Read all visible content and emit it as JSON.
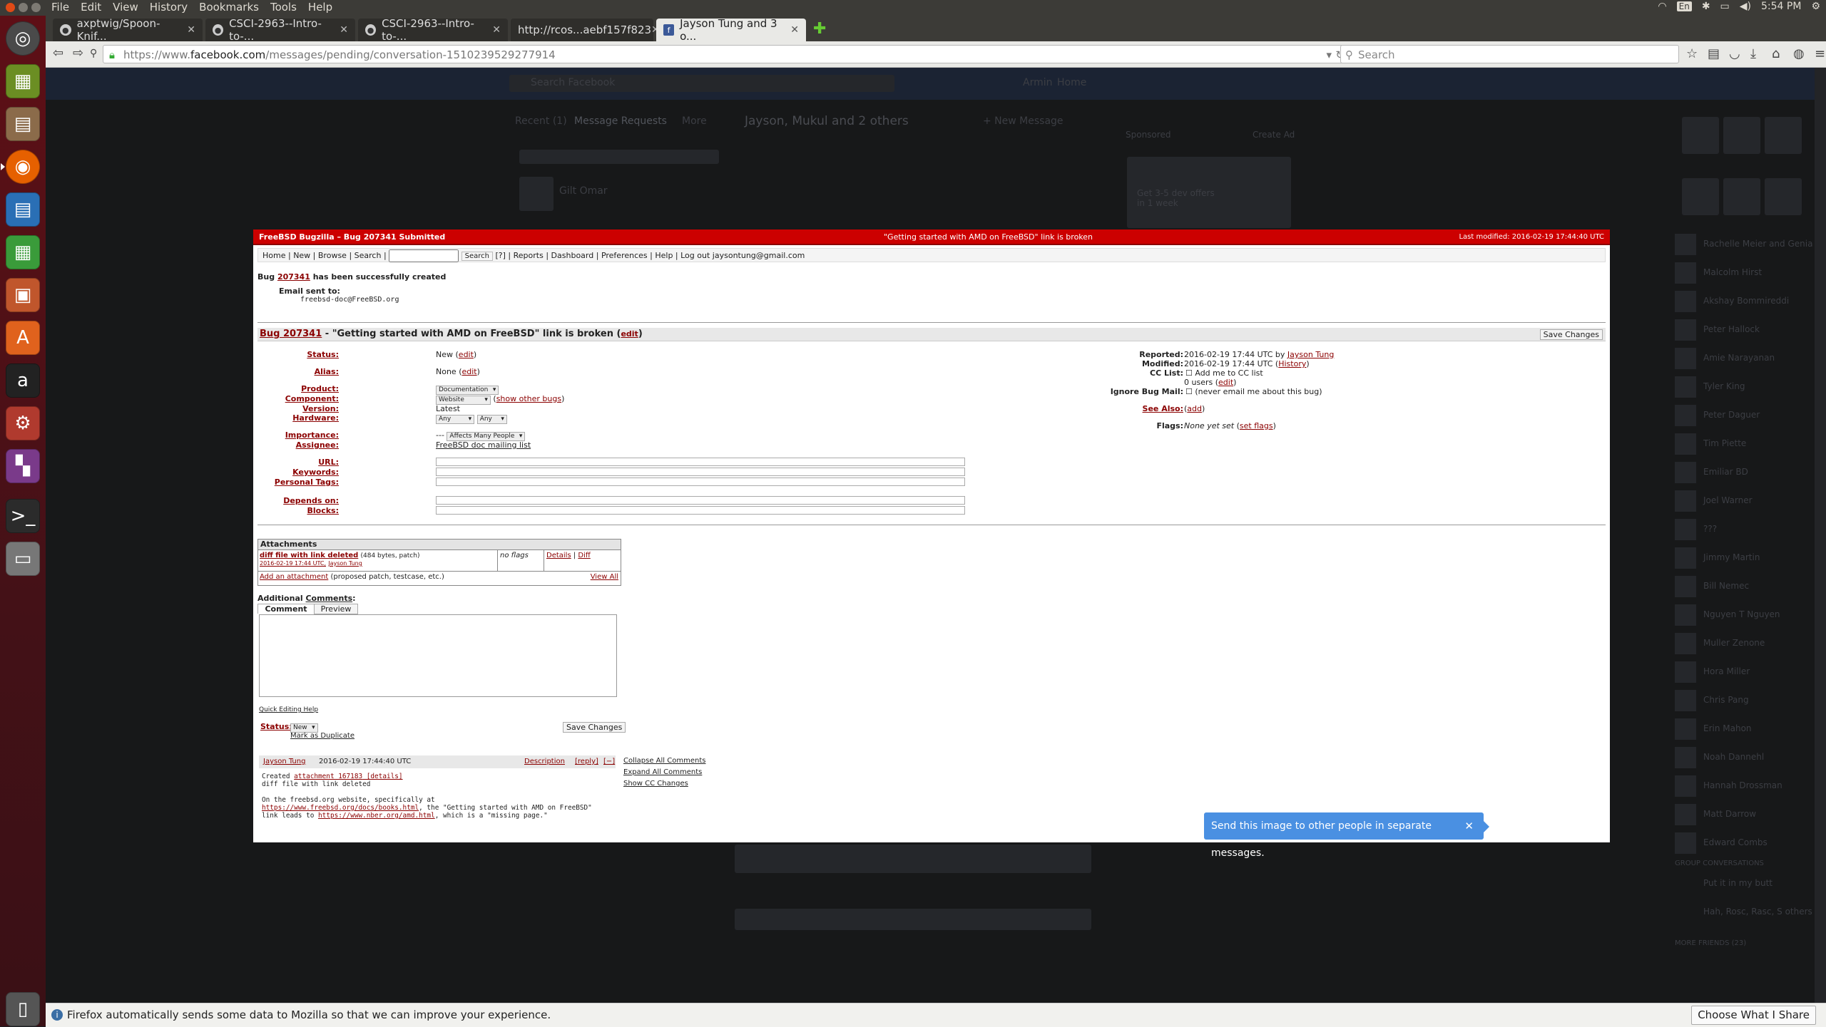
{
  "system": {
    "menu": [
      "File",
      "Edit",
      "View",
      "History",
      "Bookmarks",
      "Tools",
      "Help"
    ],
    "keyboard": "En",
    "clock": "5:54 PM"
  },
  "browser": {
    "tabs": [
      {
        "label": "axptwig/Spoon-Knif...",
        "icon": "github-icon",
        "active": false
      },
      {
        "label": "CSCI-2963--Intro-to-...",
        "icon": "github-icon",
        "active": false
      },
      {
        "label": "CSCI-2963--Intro-to-...",
        "icon": "github-icon",
        "active": false
      },
      {
        "label": "http://rcos...aebf157f823",
        "icon": "",
        "active": false
      },
      {
        "label": "Jayson Tung and 3 o...",
        "icon": "facebook-icon",
        "active": true
      }
    ],
    "url_prefix": "https://www.",
    "url_domain": "facebook.com",
    "url_path": "/messages/pending/conversation-1510239529277914",
    "search_placeholder": "Search"
  },
  "facebook_bg": {
    "search_placeholder": "Search Facebook",
    "user": "Armin",
    "home": "Home",
    "recent": "Recent (1)",
    "message_requests": "Message Requests",
    "more": "More",
    "conversation_title": "Jayson, Mukul and 2 others",
    "new_message": "+ New Message",
    "contact_name": "Gilt Omar",
    "sponsored": "Sponsored",
    "create_ad": "Create Ad",
    "ad_text": "Get 3-5 dev offers in 1 week",
    "chat_people": [
      "Rachelle Meier and Genia",
      "Malcolm Hirst",
      "Akshay Bommireddi",
      "Peter Hallock",
      "Amie Narayanan",
      "Tyler King",
      "Peter Daguer",
      "Tim Piette",
      "Emiliar BD",
      "Joel Warner",
      "???",
      "Jimmy Martin",
      "Bill Nemec",
      "Nguyen T Nguyen",
      "Muller Zenone",
      "Hora Miller",
      "Chris Pang",
      "Erin Mahon",
      "Noah Dannehl",
      "Hannah Drossman",
      "Matt Darrow",
      "Edward Combs"
    ],
    "group_conversations": "GROUP CONVERSATIONS",
    "group_items": [
      "Put it in my butt",
      "Hah, Rosc, Rasc, S others"
    ],
    "more_friends": "MORE FRIENDS (23)"
  },
  "bugzilla": {
    "header_title": "FreeBSD Bugzilla – Bug 207341 Submitted",
    "header_summary": "\"Getting started with AMD on FreeBSD\" link is broken",
    "header_modified": "Last modified: 2016-02-19 17:44:40 UTC",
    "nav": {
      "home": "Home",
      "new": "New",
      "browse": "Browse",
      "search": "Search",
      "search_button": "Search",
      "help_q": "[?]",
      "reports": "Reports",
      "dashboard": "Dashboard",
      "preferences": "Preferences",
      "help": "Help",
      "logout": "Log out",
      "email": "jaysontung@gmail.com"
    },
    "created_prefix": "Bug",
    "bug_id": "207341",
    "created_suffix": "has been successfully created",
    "email_sent_label": "Email sent to:",
    "email_sent_to": "freebsd-doc@FreeBSD.org",
    "title_bug": "Bug 207341",
    "title_text": " - \"Getting started with AMD on FreeBSD\" link is broken",
    "edit": "edit",
    "save_changes": "Save Changes",
    "fields": {
      "status_label": "Status:",
      "status_value": "New",
      "alias_label": "Alias:",
      "alias_value": "None",
      "product_label": "Product:",
      "product_value": "Documentation",
      "component_label": "Component:",
      "component_value": "Website",
      "show_other_bugs": "show other bugs",
      "version_label": "Version:",
      "version_value": "Latest",
      "hardware_label": "Hardware:",
      "hardware_value1": "Any",
      "hardware_value2": "Any",
      "importance_label": "Importance:",
      "importance_prefix": "---",
      "importance_value": "Affects Many People",
      "assignee_label": "Assignee:",
      "assignee_value": "FreeBSD doc mailing list",
      "url_label": "URL:",
      "keywords_label": "Keywords:",
      "personal_tags_label": "Personal Tags:",
      "depends_label": "Depends on:",
      "blocks_label": "Blocks:"
    },
    "right": {
      "reported_label": "Reported:",
      "reported_value": "2016-02-19 17:44 UTC by",
      "reporter": "Jayson Tung",
      "modified_label": "Modified:",
      "modified_value": "2016-02-19 17:44 UTC",
      "history": "History",
      "cc_label": "CC List:",
      "cc_add": "Add me to CC list",
      "cc_users": "0 users",
      "ignore_label": "Ignore Bug Mail:",
      "ignore_text": "(never email me about this bug)",
      "see_also_label": "See Also:",
      "add": "add",
      "flags_label": "Flags:",
      "flags_value": "None yet set",
      "set_flags": "set flags"
    },
    "attachments": {
      "header": "Attachments",
      "name": "diff file with link deleted",
      "meta": "(484 bytes, patch)",
      "date": "2016-02-19 17:44 UTC,",
      "author": "Jayson Tung",
      "flags": "no flags",
      "details": "Details",
      "diff": "Diff",
      "add": "Add an attachment",
      "add_hint": "(proposed patch, testcase, etc.)",
      "view_all": "View All"
    },
    "comments": {
      "label_a": "Additional ",
      "label_b": "Comments",
      "tab_comment": "Comment",
      "tab_preview": "Preview",
      "quick_help": "Quick Editing Help",
      "status_label": "Status:",
      "status_value": "New",
      "mark_dup": "Mark as Duplicate",
      "save_changes": "Save Changes"
    },
    "description": {
      "author": "Jayson Tung",
      "date": "2016-02-19 17:44:40 UTC",
      "desc_link": "Description",
      "reply": "[reply]",
      "collapse": "[−]",
      "line1a": "Created ",
      "line1b": "attachment 167183",
      "line1c": " [details]",
      "line2": "diff file with link deleted",
      "line3": "On the freebsd.org website, specifically at",
      "line4a": "https://www.freebsd.org/docs/books.html",
      "line4b": ", the \"Getting started with AMD on FreeBSD\"",
      "line5a": "link leads to ",
      "line5b": "https://www.nber.org/amd.html",
      "line5c": ", which is a \"missing page.\""
    },
    "comment_controls": {
      "collapse_all": "Collapse All Comments",
      "expand_all": "Expand All Comments",
      "show_cc": "Show CC Changes"
    }
  },
  "toast": "Send this image to other people in separate messages.",
  "notification": {
    "text": "Firefox automatically sends some data to Mozilla so that we can improve your experience.",
    "button": "Choose What I Share"
  }
}
